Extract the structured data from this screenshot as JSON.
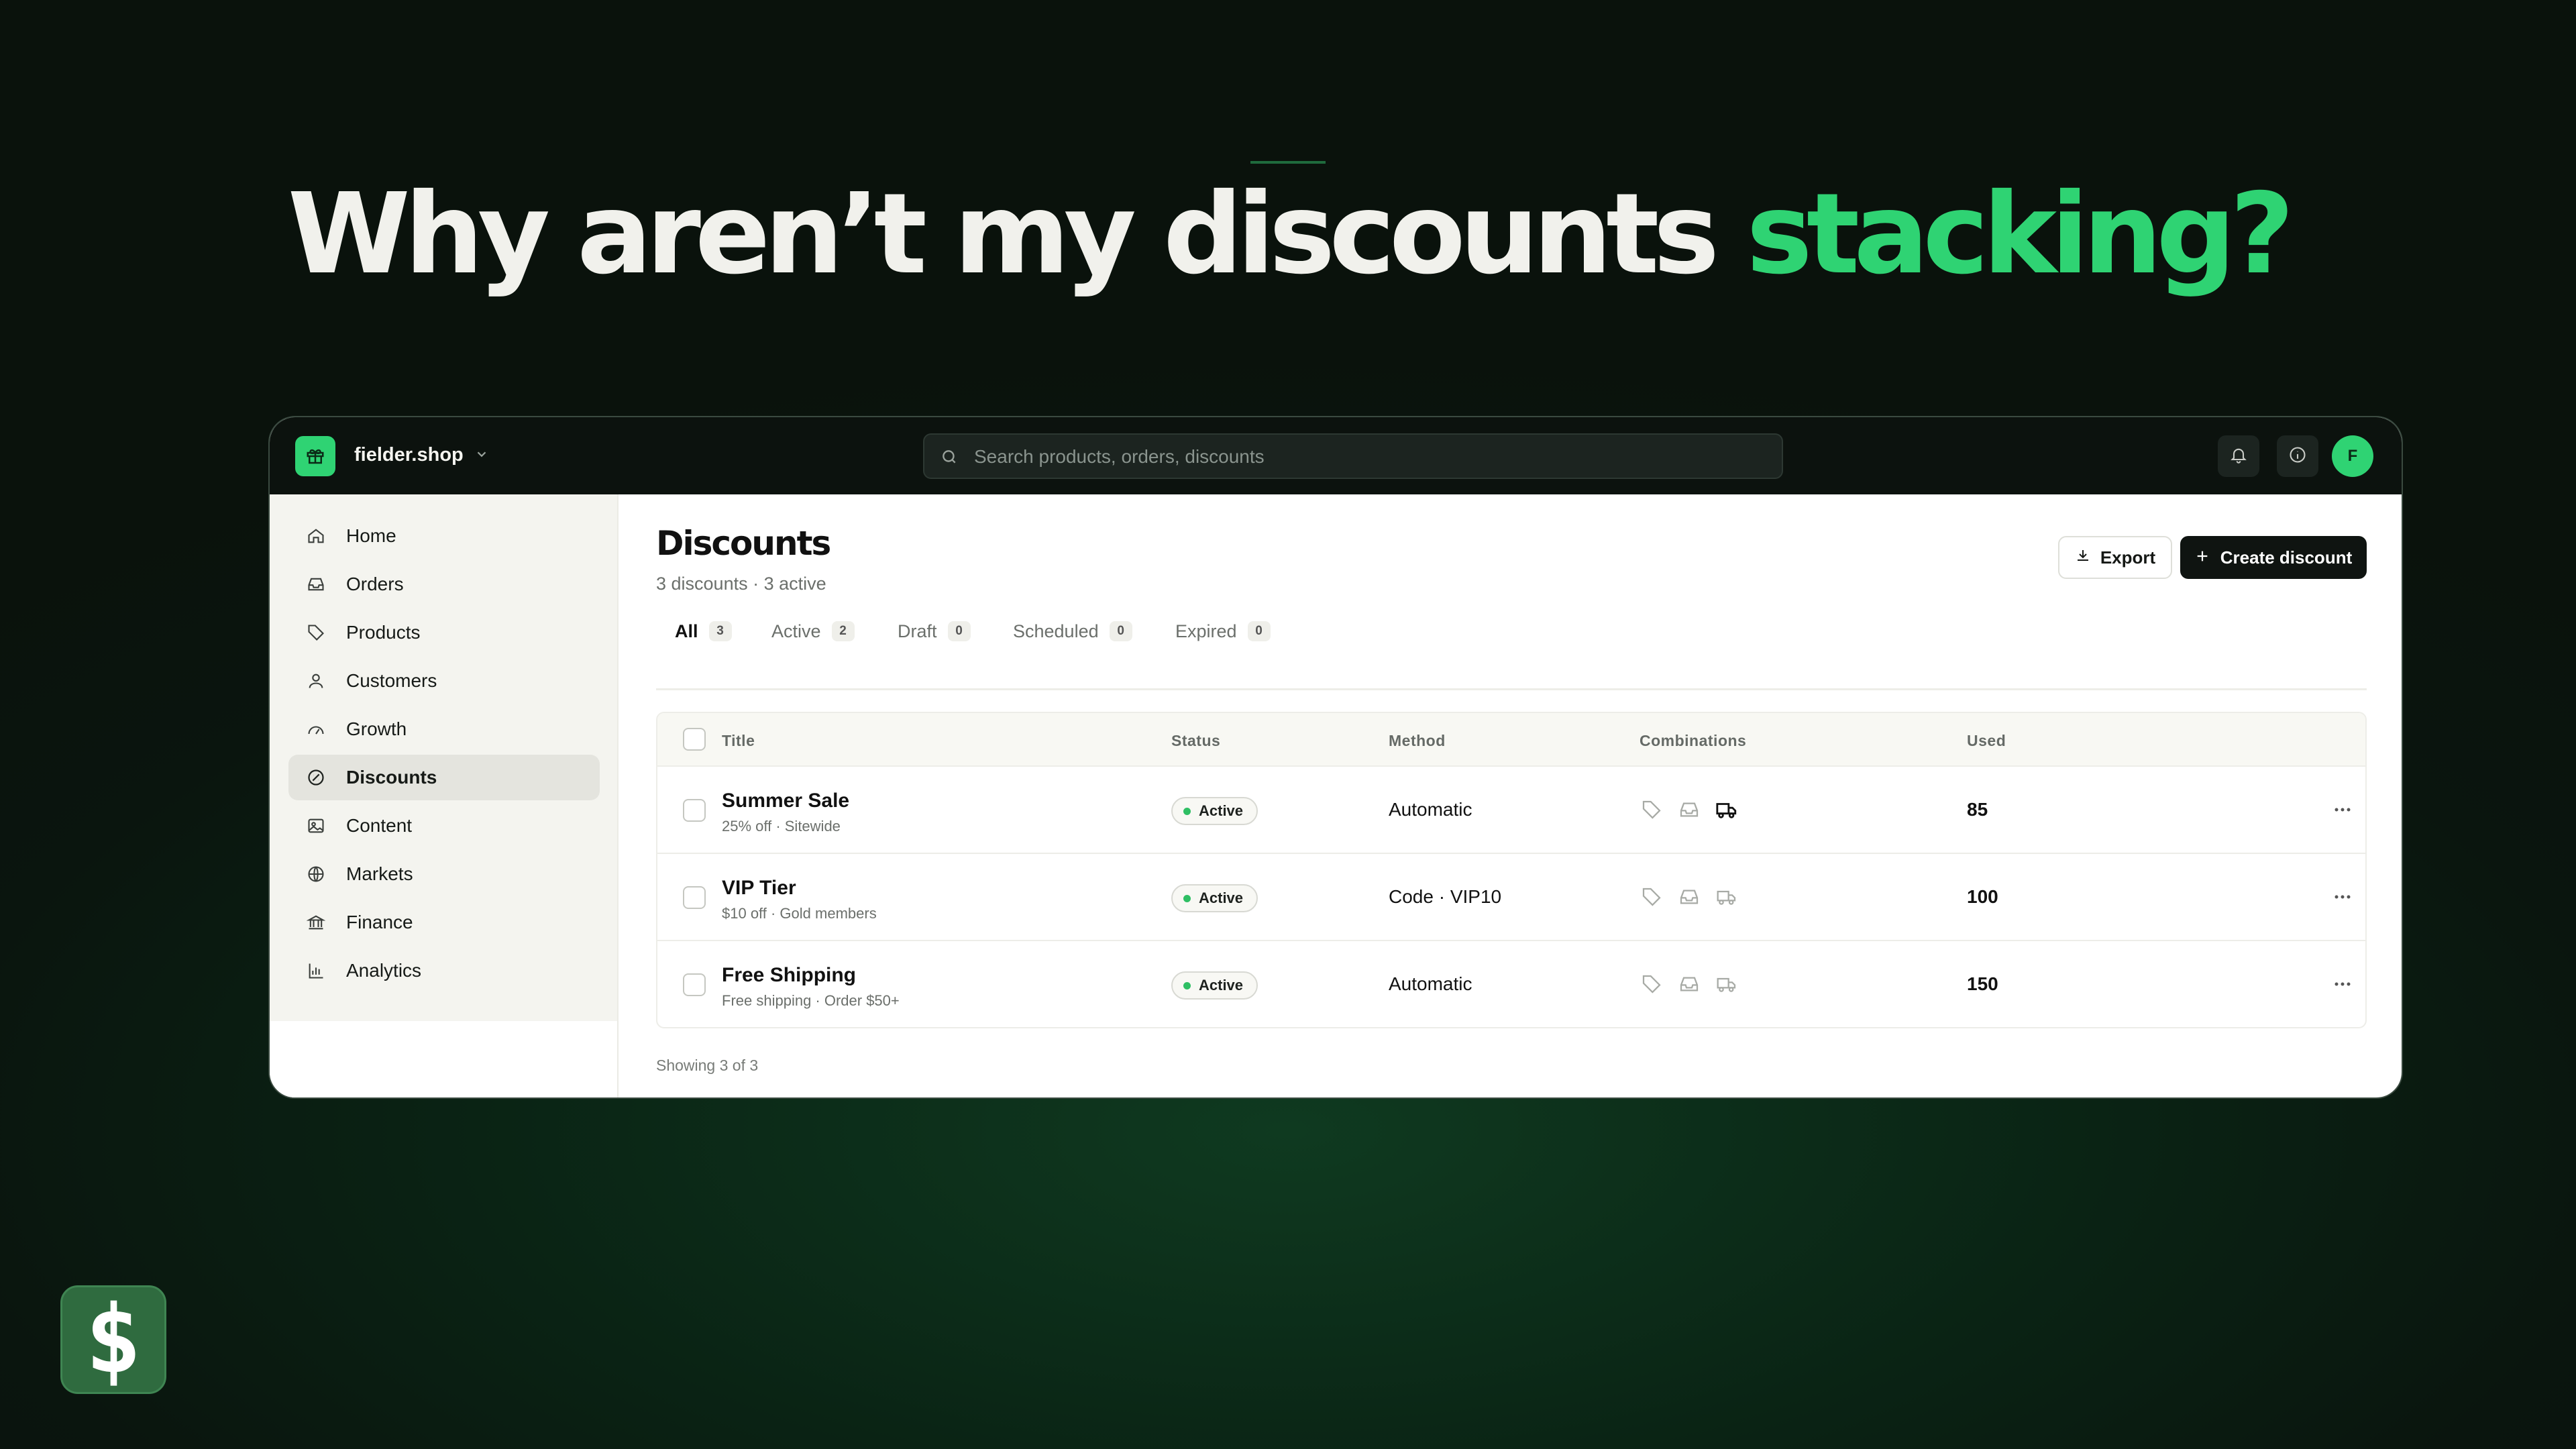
{
  "hero": {
    "title_start": "Why aren’t my discounts",
    "title_highlight": "stacking?"
  },
  "topbar": {
    "store_name": "fielder.shop",
    "search_placeholder": "Search products, orders, discounts",
    "avatar_initial": "F"
  },
  "sidebar": {
    "items": [
      {
        "label": "Home",
        "icon": "home-icon"
      },
      {
        "label": "Orders",
        "icon": "inbox-icon"
      },
      {
        "label": "Products",
        "icon": "tag-icon"
      },
      {
        "label": "Customers",
        "icon": "person-icon"
      },
      {
        "label": "Growth",
        "icon": "gauge-icon"
      },
      {
        "label": "Discounts",
        "icon": "discount-icon",
        "active": true
      },
      {
        "label": "Content",
        "icon": "image-icon"
      },
      {
        "label": "Markets",
        "icon": "globe-icon"
      },
      {
        "label": "Finance",
        "icon": "bank-icon"
      },
      {
        "label": "Analytics",
        "icon": "bar-chart-icon"
      }
    ]
  },
  "page": {
    "title": "Discounts",
    "subtitle": "3 discounts · 3 active",
    "export_label": "Export",
    "create_label": "Create discount"
  },
  "tabs": [
    {
      "label": "All",
      "count": "3",
      "active": true
    },
    {
      "label": "Active",
      "count": "2"
    },
    {
      "label": "Draft",
      "count": "0"
    },
    {
      "label": "Scheduled",
      "count": "0"
    },
    {
      "label": "Expired",
      "count": "0"
    }
  ],
  "table": {
    "columns": [
      "Title",
      "Status",
      "Method",
      "Combinations",
      "Used"
    ],
    "rows": [
      {
        "title": "Summer Sale",
        "subtitle": "25% off · Sitewide",
        "status": "Active",
        "method": "Automatic",
        "used": "85",
        "combinations_highlight": "shipping"
      },
      {
        "title": "VIP Tier",
        "subtitle": "$10 off · Gold members",
        "status": "Active",
        "method": "Code · VIP10",
        "used": "100",
        "combinations_highlight": "none"
      },
      {
        "title": "Free Shipping",
        "subtitle": "Free shipping · Order $50+",
        "status": "Active",
        "method": "Automatic",
        "used": "150",
        "combinations_highlight": "none"
      }
    ],
    "footer": "Showing 3 of 3"
  },
  "badge": {
    "symbol": "$"
  },
  "colors": {
    "accent": "#2fd373",
    "background": "#0a150e",
    "dark": "#0f1411"
  }
}
